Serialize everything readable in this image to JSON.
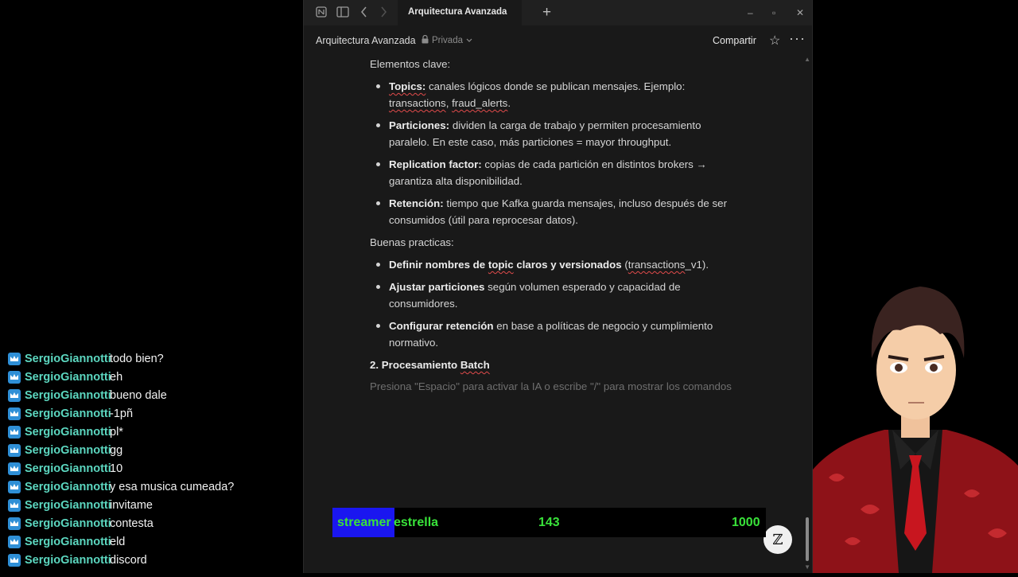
{
  "chat": [
    {
      "user": "SergioGiannotti",
      "msg": "todo bien?"
    },
    {
      "user": "SergioGiannotti",
      "msg": "eh"
    },
    {
      "user": "SergioGiannotti",
      "msg": "bueno dale"
    },
    {
      "user": "SergioGiannotti",
      "msg": "-1pñ"
    },
    {
      "user": "SergioGiannotti",
      "msg": "pl*"
    },
    {
      "user": "SergioGiannotti",
      "msg": "gg"
    },
    {
      "user": "SergioGiannotti",
      "msg": "10"
    },
    {
      "user": "SergioGiannotti",
      "msg": "y esa musica cumeada?"
    },
    {
      "user": "SergioGiannotti",
      "msg": "invitame"
    },
    {
      "user": "SergioGiannotti",
      "msg": "contesta"
    },
    {
      "user": "SergioGiannotti",
      "msg": "eld"
    },
    {
      "user": "SergioGiannotti",
      "msg": "discord"
    }
  ],
  "window": {
    "tab_title": "Arquitectura Avanzada",
    "breadcrumb": "Arquitectura Avanzada",
    "privacy": "Privada",
    "share": "Compartir"
  },
  "doc": {
    "key_elements_heading": "Elementos clave:",
    "key_elements": [
      {
        "bold": "Topics:",
        "text": " canales lógicos donde se publican mensajes. Ejemplo: transactions, fraud_alerts."
      },
      {
        "bold": "Particiones:",
        "text": " dividen la carga de trabajo y permiten procesamiento paralelo. En este caso, más particiones = mayor throughput."
      },
      {
        "bold": "Replication factor:",
        "text": " copias de cada partición en distintos brokers → garantiza alta disponibilidad."
      },
      {
        "bold": "Retención:",
        "text": " tiempo que Kafka guarda mensajes, incluso después de ser consumidos (útil para reprocesar datos)."
      }
    ],
    "practices_heading": "Buenas practicas:",
    "practices": [
      {
        "bold": "Definir nombres de topic claros y versionados",
        "text": " (transactions_v1)."
      },
      {
        "bold": "Ajustar particiones",
        "text": " según volumen esperado y capacidad de consumidores."
      },
      {
        "bold": "Configurar retención",
        "text": " en base a políticas de negocio y cumplimiento normativo."
      }
    ],
    "section_heading": "2. Procesamiento Batch",
    "placeholder": "Presiona \"Espacio\" para activar la IA o escribe \"/\" para mostrar los comandos"
  },
  "counter": {
    "label_a": "streamer",
    "label_b": "estrella",
    "current": "143",
    "goal": "1000"
  },
  "colors": {
    "chat_user": "#5cd7c0",
    "counter_text": "#39e23a",
    "counter_highlight": "#1a16f0"
  }
}
